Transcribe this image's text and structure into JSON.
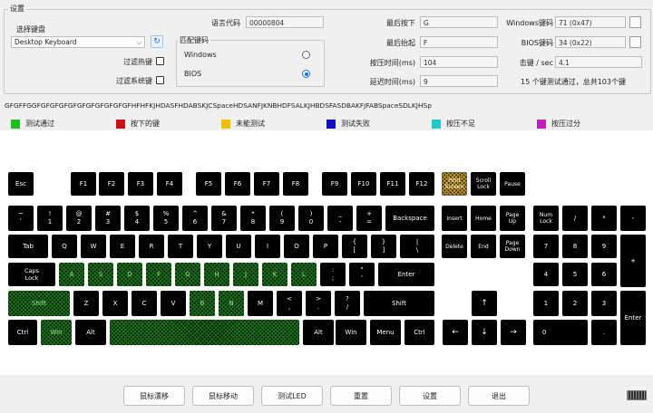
{
  "settings": {
    "group_title": "设置",
    "keyboard_select_label": "选择键盘",
    "keyboard_selected": "Desktop Keyboard",
    "filter_hotkeys_label": "过滤热键",
    "filter_system_keys_label": "过滤系统键",
    "language_code_label": "语言代码",
    "language_code_value": "00000804",
    "match_keycode_title": "匹配键码",
    "radio_windows_label": "Windows",
    "radio_bios_label": "BIOS",
    "last_pressed_label": "最后按下",
    "last_pressed_value": "G",
    "last_released_label": "最后抬起",
    "last_released_value": "F",
    "press_time_label": "按压时间(ms)",
    "press_time_value": "104",
    "latency_label": "延迟时间(ms)",
    "latency_value": "9",
    "windows_keycode_label": "Windows键码",
    "windows_keycode_value": "71 (0x47)",
    "bios_keycode_label": "BIOS键码",
    "bios_keycode_value": "34 (0x22)",
    "hits_per_sec_label": "击键 / sec",
    "hits_per_sec_value": "4.1",
    "summary_text": "15 个键测试通过，总共103个键"
  },
  "key_history": "GFGFFGGFGFGFGFGFGFGFGFGFGFGFHFHFKJHDASFHDABSKJCSpaceHDSANFJKNBHDFSALKJHBDSFASDBAKFJFABSpaceSDLKJHSp",
  "legend": [
    {
      "label": "测试通过",
      "color": "#1fbf1f"
    },
    {
      "label": "按下的键",
      "color": "#c81414"
    },
    {
      "label": "未能测试",
      "color": "#f0c000"
    },
    {
      "label": "测试失败",
      "color": "#1010c0"
    },
    {
      "label": "按压不足",
      "color": "#20c8c8"
    },
    {
      "label": "按压过分",
      "color": "#c020c0"
    }
  ],
  "keys": {
    "esc": "Esc",
    "f1": "F1",
    "f2": "F2",
    "f3": "F3",
    "f4": "F4",
    "f5": "F5",
    "f6": "F6",
    "f7": "F7",
    "f8": "F8",
    "f9": "F9",
    "f10": "F10",
    "f11": "F11",
    "f12": "F12",
    "print": "Print\nScreen",
    "scroll": "Scroll\nLock",
    "pause": "Pause",
    "tilde": "~\n`",
    "k1": "!\n1",
    "k2": "@\n2",
    "k3": "#\n3",
    "k4": "$\n4",
    "k5": "%\n5",
    "k6": "^\n6",
    "k7": "&\n7",
    "k8": "*\n8",
    "k9": "(\n9",
    "k0": ")\n0",
    "minus": "_\n-",
    "equal": "+\n=",
    "backspace": "Backspace",
    "insert": "Insert",
    "home": "Home",
    "pgup": "Page\nUp",
    "numlock": "Num\nLock",
    "ndiv": "/",
    "nmul": "*",
    "nsub": "-",
    "tab": "Tab",
    "q": "Q",
    "w": "W",
    "e": "E",
    "r": "R",
    "t": "T",
    "y": "Y",
    "u": "U",
    "i": "I",
    "o": "O",
    "p": "P",
    "lbr": "{\n[",
    "rbr": "}\n]",
    "bslash": "|\n\\",
    "delete": "Delete",
    "end": "End",
    "pgdn": "Page\nDown",
    "n7": "7",
    "n8": "8",
    "n9": "9",
    "nadd": "+",
    "caps": "Caps\nLock",
    "a": "A",
    "s": "S",
    "d": "D",
    "f": "F",
    "g": "G",
    "h": "H",
    "j": "J",
    "k": "K",
    "l": "L",
    "semi": ":\n;",
    "quote": "\"\n'",
    "enter": "Enter",
    "n4": "4",
    "n5": "5",
    "n6": "6",
    "lshift": "Shift",
    "z": "Z",
    "x": "X",
    "c": "C",
    "v": "V",
    "b": "B",
    "n": "N",
    "m": "M",
    "comma": "<\n,",
    "period": ">\n.",
    "slash": "?\n/",
    "rshift": "Shift",
    "up": "↑",
    "n1": "1",
    "n2": "2",
    "n3": "3",
    "nenter": "Enter",
    "lctrl": "Ctrl",
    "lwin": "Win",
    "lalt": "Alt",
    "space": "",
    "ralt": "Alt",
    "rwin": "Win",
    "menu": "Menu",
    "rctrl": "Ctrl",
    "left": "←",
    "down": "↓",
    "right": "→",
    "n0": "0",
    "ndot": "."
  },
  "buttons": {
    "mouse_hover": "鼠标漂移",
    "mouse_move": "鼠标移动",
    "test_led": "测试LED",
    "reset": "重置",
    "settings": "设置",
    "exit": "退出"
  }
}
